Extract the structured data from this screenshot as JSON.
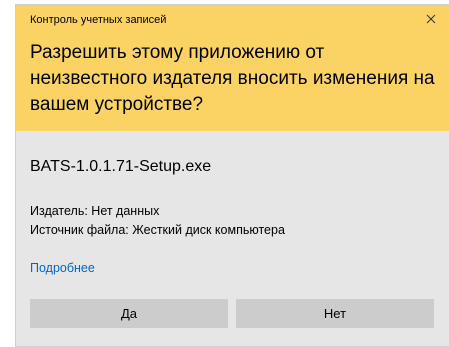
{
  "window": {
    "title": "Контроль учетных записей",
    "close_icon": "close-icon",
    "header_color": "#fbd264",
    "body_color": "#e6e6e6"
  },
  "prompt": {
    "question": "Разрешить этому приложению от неизвестного издателя вносить изменения на вашем устройстве?"
  },
  "program": {
    "filename": "BATS-1.0.1.71-Setup.exe",
    "publisher": "Издатель: Нет данных",
    "source": "Источник файла: Жесткий диск компьютера"
  },
  "links": {
    "more": "Подробнее",
    "link_color": "#0066cc"
  },
  "buttons": {
    "yes": "Да",
    "no": "Нет",
    "button_color": "#cccccc"
  }
}
